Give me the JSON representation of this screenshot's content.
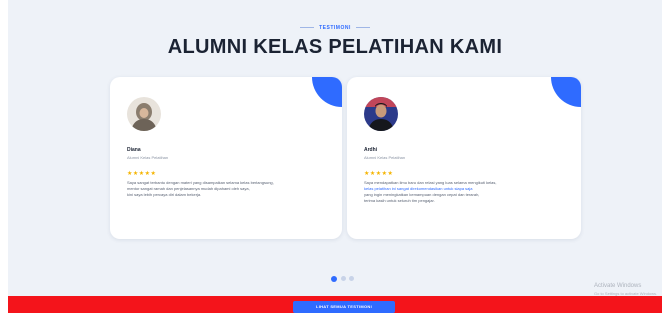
{
  "section": {
    "eyebrow": "TESTIMONI",
    "title": "ALUMNI KELAS PELATIHAN KAMI"
  },
  "testimonials": [
    {
      "name": "Diana",
      "role": "Alumni Kelas Pelatihan",
      "rating": 5,
      "stars": "★★★★★",
      "quote_lines": [
        "Saya sangat terbantu dengan materi yang disampaikan selama kelas berlangsung,",
        "mentor sangat ramah dan penjelasannya mudah dipahami oleh saya,",
        "kini saya lebih percaya diri dalam bekerja."
      ]
    },
    {
      "name": "Ardhi",
      "role": "Alumni Kelas Pelatihan",
      "rating": 5,
      "stars": "★★★★★",
      "quote_lines": [
        "Saya mendapatkan ilmu baru dan relasi yang luas selama mengikuti kelas,",
        "kelas pelatihan ini sangat direkomendasikan untuk siapa saja",
        "yang ingin meningkatkan kemampuan dengan cepat dan terarah,",
        "terima kasih untuk seluruh tim pengajar."
      ]
    }
  ],
  "carousel": {
    "total": 3,
    "active_index": 0
  },
  "cta": {
    "label": "LIHAT SEMUA TESTIMONI"
  },
  "os_watermark": {
    "line1": "Activate Windows",
    "line2": "Go to Settings to activate Windows."
  },
  "colors": {
    "accent": "#2f6bff",
    "bottom_bar": "#f4141b",
    "star": "#f5b400",
    "section_bg": "#eef2f8"
  }
}
